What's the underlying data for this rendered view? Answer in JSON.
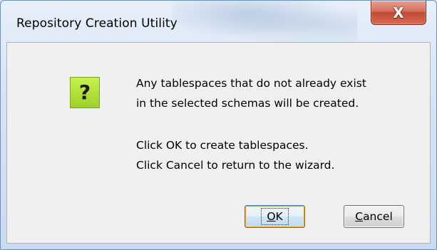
{
  "window": {
    "title": "Repository Creation Utility",
    "close_glyph": "X"
  },
  "icon": {
    "name": "question-icon",
    "glyph": "?",
    "color": "#b1e03a"
  },
  "message": {
    "line1": "Any tablespaces that do not already exist",
    "line2": "in the selected schemas will be created.",
    "line3": "Click OK to create tablespaces.",
    "line4": "Click Cancel to return to the wizard."
  },
  "buttons": {
    "ok": {
      "mnemonic": "O",
      "rest": "K"
    },
    "cancel": {
      "mnemonic": "C",
      "rest": "ancel"
    }
  }
}
